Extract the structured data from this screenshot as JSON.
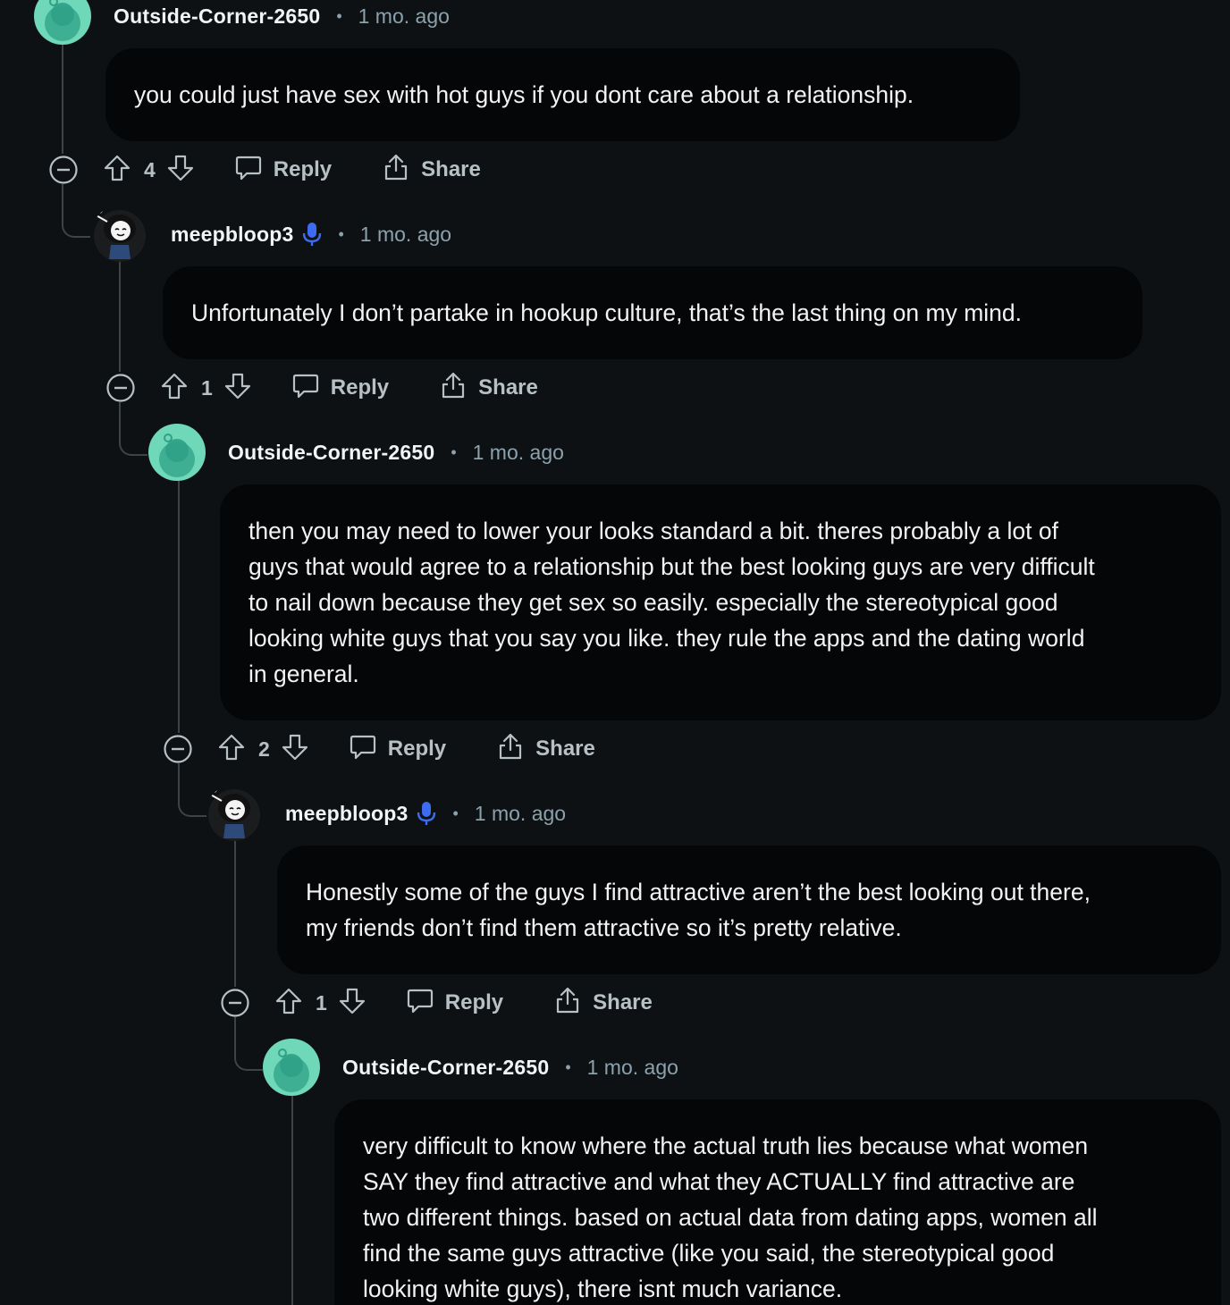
{
  "comments": [
    {
      "username": "Outside-Corner-2650",
      "time": "1 mo. ago",
      "avatar": "snoo-avatar",
      "body": "you could just have sex with hot guys if you dont care about a relationship.",
      "votes": "4",
      "reply_label": "Reply",
      "share_label": "Share"
    },
    {
      "username": "meepbloop3",
      "time": "1 mo. ago",
      "avatar": "meep-avatar",
      "badge_icon": "microphone-icon",
      "body": "Unfortunately I don’t partake in hookup culture, that’s the last thing on my mind.",
      "votes": "1",
      "reply_label": "Reply",
      "share_label": "Share"
    },
    {
      "username": "Outside-Corner-2650",
      "time": "1 mo. ago",
      "avatar": "snoo-avatar",
      "body": "then you may need to lower your looks standard a bit. theres probably a lot of\nguys that would agree to a relationship but the best looking guys are very difficult\nto nail down because they get sex so easily. especially the stereotypical good\nlooking white guys that you say you like. they rule the apps and the dating world\nin general.",
      "votes": "2",
      "reply_label": "Reply",
      "share_label": "Share"
    },
    {
      "username": "meepbloop3",
      "time": "1 mo. ago",
      "avatar": "meep-avatar",
      "badge_icon": "microphone-icon",
      "body": "Honestly some of the guys I find attractive aren’t the best looking out there,\nmy friends don’t find them attractive so it’s pretty relative.",
      "votes": "1",
      "reply_label": "Reply",
      "share_label": "Share"
    },
    {
      "username": "Outside-Corner-2650",
      "time": "1 mo. ago",
      "avatar": "snoo-avatar",
      "body": "very difficult to know where the actual truth lies because what women\nSAY they find attractive and what they ACTUALLY find attractive are\ntwo different things. based on actual data from dating apps, women all\nfind the same guys attractive (like you said, the stereotypical good\nlooking white guys), there isnt much variance."
    }
  ],
  "separator": "•",
  "colors": {
    "background": "#0e1113",
    "bubble": "#050607",
    "snoo": "#6fd8b8",
    "mic": "#3d6cf0",
    "muted": "#8ba2ad"
  }
}
